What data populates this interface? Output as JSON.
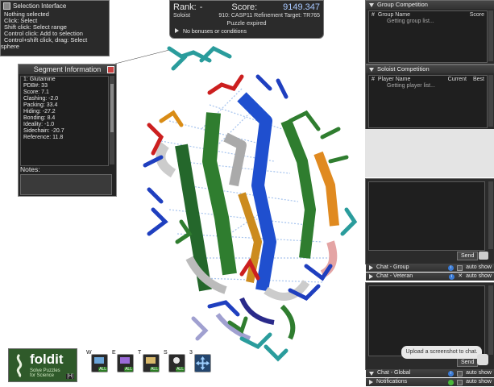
{
  "selection": {
    "title": "Selection Interface",
    "lines": [
      "Nothing selected",
      "Click: Select",
      "Shift click: Select range",
      "Control click: Add to selection",
      "Control+shift click, drag: Select",
      "sphere"
    ]
  },
  "score": {
    "rank_label": "Rank:",
    "rank_value": "-",
    "score_label": "Score:",
    "score_value": "9149.347",
    "mode": "Soloist",
    "puzzle": "910: CASP11 Refinement Target: TR765",
    "status": "Puzzle expired",
    "bonuses": "No bonuses or conditions"
  },
  "segment": {
    "title": "Segment Information",
    "lines": [
      "1: Glutamine",
      "",
      "PDB#:    33",
      "",
      "Score: 7.1",
      "",
      "Clashing: -2.0",
      "Packing: 33.4",
      "Hiding: -27.2",
      "Bonding: 8.4",
      "Ideality: -1.0",
      "Sidechain: -20.7",
      "Reference: 11.8"
    ],
    "notes_label": "Notes:"
  },
  "group": {
    "title": "Group Competition",
    "col_rank": "#",
    "col_name": "Group Name",
    "col_score": "Score",
    "loading": "Getting group list..."
  },
  "soloist": {
    "title": "Soloist Competition",
    "col_rank": "#",
    "col_name": "Player Name",
    "col_current": "Current",
    "col_best": "Best",
    "loading": "Getting player list..."
  },
  "chat": {
    "send_label": "Send",
    "group_label": "Chat - Group",
    "veteran_label": "Chat - Veteran",
    "global_label": "Chat - Global",
    "notifications_label": "Notifications",
    "auto_show": "auto show",
    "tooltip": "Upload a screenshot to chat."
  },
  "logo": {
    "name": "foldit",
    "tagline_1": "Solve Puzzles",
    "tagline_2": "for Science",
    "help_key": "[H]"
  },
  "toolbar": [
    {
      "key": "W",
      "badge": "ALL",
      "icon": "wiggle-icon"
    },
    {
      "key": "E",
      "badge": "ALL",
      "icon": "shake-icon"
    },
    {
      "key": "T",
      "badge": "ALL",
      "icon": "tweak-icon"
    },
    {
      "key": "S",
      "badge": "ALL",
      "icon": "sidechain-icon"
    },
    {
      "key": "3",
      "badge": "",
      "icon": "move-icon"
    }
  ],
  "colors": {
    "panel_bg": "#2b2b2b",
    "accent_green": "#2d7d25",
    "score_value": "#a8c8ff",
    "close_red": "#c94040"
  }
}
